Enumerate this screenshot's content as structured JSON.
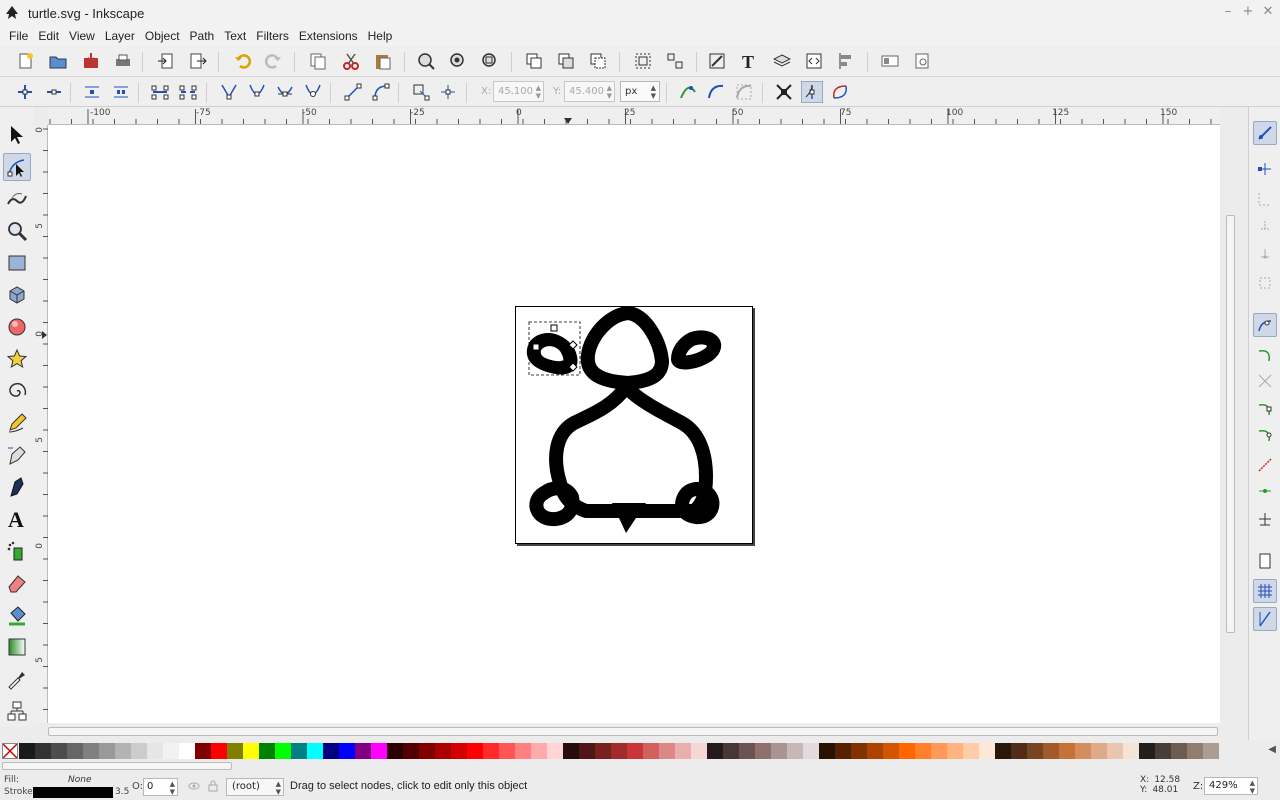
{
  "window": {
    "title": "turtle.svg - Inkscape"
  },
  "menu": [
    "File",
    "Edit",
    "View",
    "Layer",
    "Object",
    "Path",
    "Text",
    "Filters",
    "Extensions",
    "Help"
  ],
  "command_bar_icons": [
    "new-document-icon",
    "open-icon",
    "save-icon",
    "print-icon",
    "import-icon",
    "export-icon",
    "undo-icon",
    "redo-icon",
    "copy-icon",
    "cut-icon",
    "paste-icon",
    "zoom-selection-icon",
    "zoom-drawing-icon",
    "zoom-page-icon",
    "duplicate-icon",
    "clone-icon",
    "unlink-clone-icon",
    "group-icon",
    "ungroup-icon",
    "fill-stroke-icon",
    "text-font-icon",
    "layers-icon",
    "xml-editor-icon",
    "align-distribute-icon",
    "document-properties-icon",
    "preferences-icon"
  ],
  "node_toolbar": {
    "x_label": "X:",
    "x_value": "45.100",
    "y_label": "Y:",
    "y_value": "45.400",
    "unit": "px"
  },
  "rulers": {
    "h_labels": [
      "-100",
      "-75",
      "-50",
      "-25",
      "0",
      "25",
      "50",
      "75",
      "100",
      "125",
      "150"
    ],
    "v_labels": [
      "0",
      "5",
      "0",
      "5",
      "0",
      "5"
    ]
  },
  "palette_colors": [
    "#1a1a1a",
    "#333333",
    "#4d4d4d",
    "#666666",
    "#808080",
    "#999999",
    "#b3b3b3",
    "#cccccc",
    "#e6e6e6",
    "#f2f2f2",
    "#ffffff",
    "#800000",
    "#ff0000",
    "#808000",
    "#ffff00",
    "#008000",
    "#00ff00",
    "#008080",
    "#00ffff",
    "#000080",
    "#0000ff",
    "#800080",
    "#ff00ff",
    "#2b0000",
    "#550000",
    "#800000",
    "#aa0000",
    "#d40000",
    "#ff0000",
    "#ff2a2a",
    "#ff5555",
    "#ff8080",
    "#ffaaaa",
    "#ffd5d5",
    "#280b0b",
    "#501616",
    "#782121",
    "#a02c2c",
    "#c83737",
    "#d35f5f",
    "#de8787",
    "#e9afaf",
    "#f4d7d7",
    "#241c1c",
    "#483737",
    "#6c5353",
    "#916f6f",
    "#ac9393",
    "#c8b7b7",
    "#e3dbdb",
    "#2b1100",
    "#552200",
    "#803300",
    "#aa4400",
    "#d45500",
    "#ff6600",
    "#ff7f2a",
    "#ff9955",
    "#ffb380",
    "#ffccaa",
    "#ffe6d5",
    "#28170b",
    "#502d16",
    "#784421",
    "#a05a2c",
    "#c87137",
    "#d38d5f",
    "#deaa87",
    "#e9c6af",
    "#f4e3d7",
    "#241f1c",
    "#483e37",
    "#6c5d53",
    "#917c6f",
    "#ac9d93"
  ],
  "status": {
    "fill_label": "Fill:",
    "fill_value": "None",
    "stroke_label": "Stroke:",
    "stroke_width": "3.5",
    "opacity_label": "O:",
    "opacity_value": "0",
    "layer": "(root)",
    "message": "Drag to select nodes, click to edit only this object",
    "x_label": "X:",
    "x": "12.58",
    "y_label": "Y:",
    "y": "48.01",
    "zoom_label": "Z:",
    "zoom": "429%"
  }
}
